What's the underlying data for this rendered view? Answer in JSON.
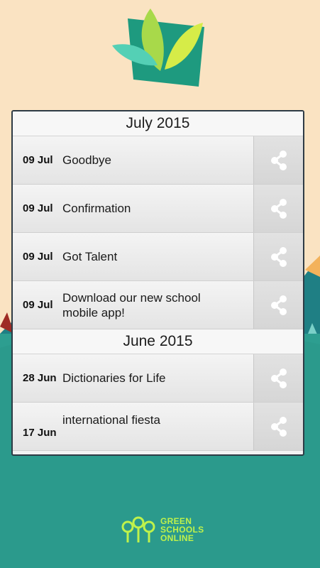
{
  "sections": [
    {
      "header": "July 2015",
      "items": [
        {
          "date": "09 Jul",
          "title": "Goodbye"
        },
        {
          "date": "09 Jul",
          "title": "Confirmation"
        },
        {
          "date": "09 Jul",
          "title": "Got Talent"
        },
        {
          "date": "09 Jul",
          "title": "Download our new school mobile app!"
        }
      ]
    },
    {
      "header": "June 2015",
      "items": [
        {
          "date": "28 Jun",
          "title": "Dictionaries for Life"
        },
        {
          "date": "17 Jun",
          "title": "international fiesta"
        }
      ]
    }
  ],
  "icons": {
    "share": "share-icon",
    "logo": "leaf-logo",
    "brand": "green-schools-online-logo"
  },
  "brand": {
    "line1": "GREEN",
    "line2": "SCHOOLS",
    "line3": "ONLINE"
  },
  "colors": {
    "background": "#fae3c2",
    "ground": "#2d9e90",
    "brand_green": "#bff24b",
    "panel_border": "#2e3b45"
  }
}
